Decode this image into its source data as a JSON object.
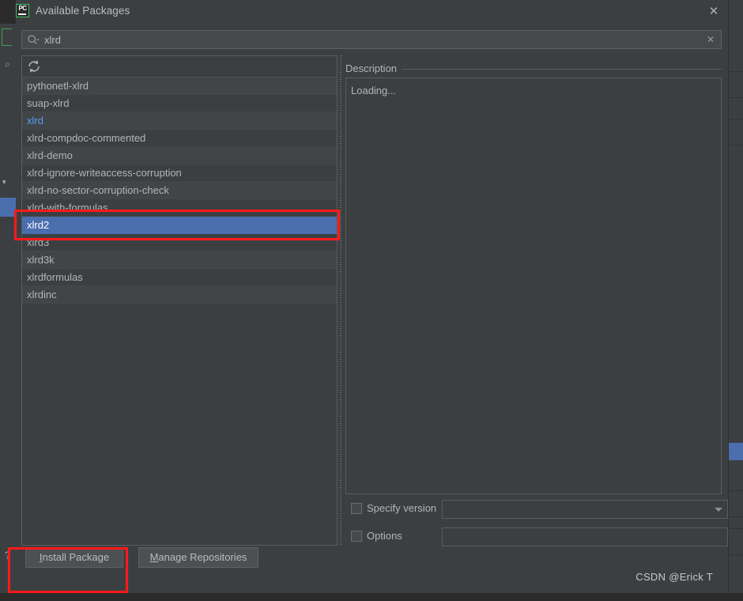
{
  "dialog": {
    "title": "Available Packages",
    "app_icon": "pycharm-icon",
    "close_icon": "close-icon"
  },
  "search": {
    "value": "xlrd",
    "placeholder": "",
    "icon": "search-icon",
    "clear_icon": "clear-icon"
  },
  "list": {
    "refresh_icon": "refresh-icon",
    "packages": [
      {
        "name": "pythonetl-xlrd",
        "state": "normal"
      },
      {
        "name": "suap-xlrd",
        "state": "normal"
      },
      {
        "name": "xlrd",
        "state": "installed"
      },
      {
        "name": "xlrd-compdoc-commented",
        "state": "normal"
      },
      {
        "name": "xlrd-demo",
        "state": "normal"
      },
      {
        "name": "xlrd-ignore-writeaccess-corruption",
        "state": "normal"
      },
      {
        "name": "xlrd-no-sector-corruption-check",
        "state": "normal"
      },
      {
        "name": "xlrd-with-formulas",
        "state": "normal"
      },
      {
        "name": "xlrd2",
        "state": "selected"
      },
      {
        "name": "xlrd3",
        "state": "normal"
      },
      {
        "name": "xlrd3k",
        "state": "normal"
      },
      {
        "name": "xlrdformulas",
        "state": "normal"
      },
      {
        "name": "xlrdinc",
        "state": "normal"
      }
    ]
  },
  "description": {
    "header": "Description",
    "body": "Loading..."
  },
  "options": {
    "specify_version": {
      "label": "Specify version",
      "checked": false,
      "value": "",
      "control": "combobox"
    },
    "options_flag": {
      "label": "Options",
      "checked": false,
      "value": "",
      "control": "textfield"
    }
  },
  "buttons": {
    "install": {
      "prefix": "I",
      "rest": "nstall Package"
    },
    "manage": {
      "prefix": "M",
      "rest": "anage Repositories"
    }
  },
  "watermark": "CSDN @Erick T",
  "colors": {
    "panel_bg": "#3c3f41",
    "selection_blue": "#4b6eaf",
    "installed_link_blue": "#589df6",
    "annotation_red": "#ff1a1a",
    "accent_green": "#3ec05a",
    "text": "#b4b4b4"
  }
}
